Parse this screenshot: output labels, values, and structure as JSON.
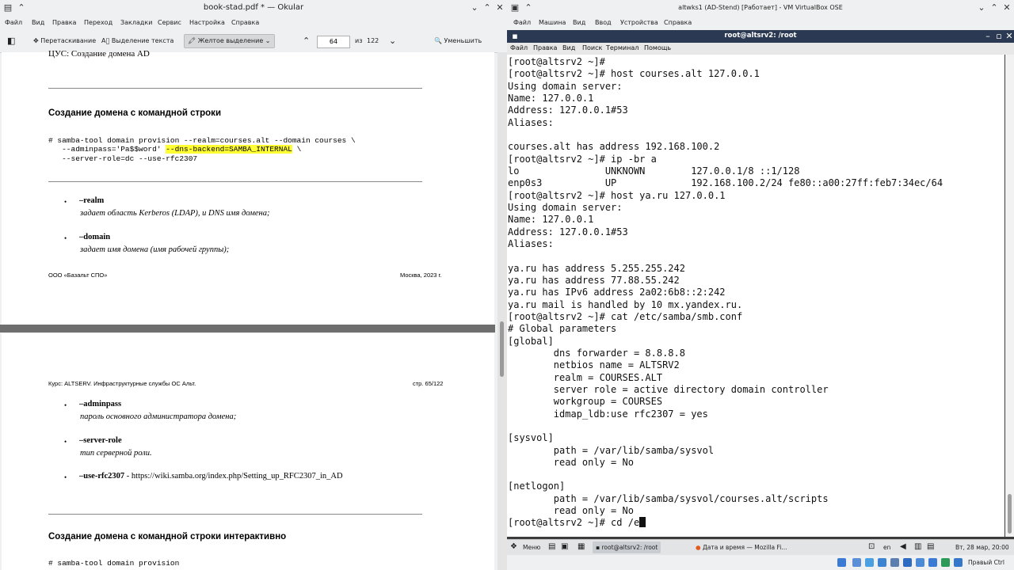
{
  "okular": {
    "title": "book-stad.pdf * — Okular",
    "menu": [
      "Файл",
      "Вид",
      "Правка",
      "Переход",
      "Закладки",
      "Сервис",
      "Настройка",
      "Справка"
    ],
    "toolbar": {
      "drag": "Перетаскивание",
      "text_select": "Выделение текста",
      "yellow_highlight": "Желтое выделение",
      "page_current": "64",
      "page_of": "из",
      "page_total": "122",
      "zoom_out": "Уменьшить"
    },
    "page1": {
      "top_text": "ЦУС: Создание домена AD",
      "heading": "Создание домена с командной строки",
      "code_line1": "# samba-tool domain provision --realm=courses.alt --domain courses \\",
      "code_line2_a": "   --adminpass='Pa$$word' ",
      "code_line2_hl": "--dns-backend=SAMBA_INTERNAL",
      "code_line2_b": " \\",
      "code_line3": "   --server-role=dc --use-rfc2307",
      "items": [
        {
          "option": "–realm",
          "desc": "задает область Kerberos (LDAP), и DNS имя домена;"
        },
        {
          "option": "–domain",
          "desc": "задает имя домена (имя рабочей группы);"
        }
      ],
      "footer_left": "ООО «Базальт СПО»",
      "footer_right": "Москва, 2023 г."
    },
    "page2": {
      "header_left": "Курс: ALTSERV. Инфраструктурные службы ОС Альт.",
      "header_right": "стр. 65/122",
      "items": [
        {
          "option": "–adminpass",
          "desc": "пароль основного администратора домена;"
        },
        {
          "option": "–server-role",
          "desc": "тип серверной роли."
        },
        {
          "option": "–use-rfc2307",
          "desc": " - https://wiki.samba.org/index.php/Setting_up_RFC2307_in_AD"
        }
      ],
      "heading": "Создание домена с командной строки интерактивно",
      "code_line1": "# samba-tool domain provision"
    }
  },
  "vbox": {
    "title": "altwks1 (AD-Stend) [Работает] - VM VirtualBox OSE",
    "menu": [
      "Файл",
      "Машина",
      "Вид",
      "Ввод",
      "Устройства",
      "Справка"
    ]
  },
  "terminal": {
    "title": "root@altsrv2: /root",
    "menu": [
      "Файл",
      "Правка",
      "Вид",
      "Поиск",
      "Терминал",
      "Помощь"
    ],
    "lines": [
      "[root@altsrv2 ~]#",
      "[root@altsrv2 ~]# host courses.alt 127.0.0.1",
      "Using domain server:",
      "Name: 127.0.0.1",
      "Address: 127.0.0.1#53",
      "Aliases:",
      "",
      "courses.alt has address 192.168.100.2",
      "[root@altsrv2 ~]# ip -br a",
      "lo               UNKNOWN        127.0.0.1/8 ::1/128",
      "enp0s3           UP             192.168.100.2/24 fe80::a00:27ff:feb7:34ec/64",
      "[root@altsrv2 ~]# host ya.ru 127.0.0.1",
      "Using domain server:",
      "Name: 127.0.0.1",
      "Address: 127.0.0.1#53",
      "Aliases:",
      "",
      "ya.ru has address 5.255.255.242",
      "ya.ru has address 77.88.55.242",
      "ya.ru has IPv6 address 2a02:6b8::2:242",
      "ya.ru mail is handled by 10 mx.yandex.ru.",
      "[root@altsrv2 ~]# cat /etc/samba/smb.conf",
      "# Global parameters",
      "[global]",
      "        dns forwarder = 8.8.8.8",
      "        netbios name = ALTSRV2",
      "        realm = COURSES.ALT",
      "        server role = active directory domain controller",
      "        workgroup = COURSES",
      "        idmap_ldb:use rfc2307 = yes",
      "",
      "[sysvol]",
      "        path = /var/lib/samba/sysvol",
      "        read only = No",
      "",
      "[netlogon]",
      "        path = /var/lib/samba/sysvol/courses.alt/scripts",
      "        read only = No"
    ],
    "prompt_line": "[root@altsrv2 ~]# cd /e"
  },
  "guest_taskbar": {
    "menu": "Меню",
    "task_terminal": "root@altsrv2: /root",
    "task_firefox": "Дата и время — Mozilla Fi...",
    "lang": "en",
    "clock": "Вт, 28 мар, 20:00"
  },
  "vb_status": {
    "host_key": "Правый Ctrl"
  }
}
